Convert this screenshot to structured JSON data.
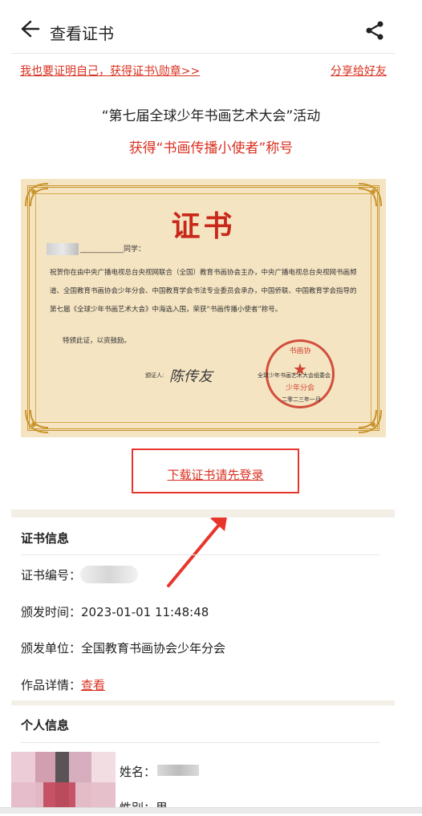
{
  "header": {
    "title": "查看证书",
    "back_icon": "back-arrow-icon",
    "share_icon": "share-icon"
  },
  "links": {
    "prove_self": "我也要证明自己，获得证书\\勋章>>",
    "share_friend": "分享给好友"
  },
  "event": {
    "name": "“第七届全球少年书画艺术大会”活动",
    "award": "获得“书画传播小使者”称号"
  },
  "certificate": {
    "title": "证书",
    "greeting": "____________同学：",
    "body": "祝贺你在由中央广播电视总台央视网联合（全国）教育书画协会主办，中央广播电视总台央视网书画频道、全国教育书画协会少年分会、中国教育学会书法专业委员会承办，中国侨联、中国教育学会指导的第七届《全球少年书画艺术大会》中海选入围，荣获“书画传播小使者”称号。",
    "tail": "特颁此证，以资鼓励。",
    "signer_label": "颁证人:",
    "signature": "陈传友",
    "org": "全球少年书画艺术大会组委会",
    "date": "二零二三年一月",
    "seal_top": "书画协",
    "seal_bottom": "少年分会",
    "colors": {
      "paper": "#f5e4c2",
      "gold": "#c8952e",
      "seal": "#c8281a"
    }
  },
  "download": {
    "label": "下载证书请先登录"
  },
  "cert_info": {
    "section_title": "证书信息",
    "number_label": "证书编号：",
    "time_label": "颁发时间：",
    "time_value": "2023-01-01 11:48:48",
    "issuer_label": "颁发单位：",
    "issuer_value": "全国教育书画协会少年分会",
    "work_label": "作品详情：",
    "work_link": "查看"
  },
  "personal_info": {
    "section_title": "个人信息",
    "name_label": "姓名：",
    "gender_label": "性别：男"
  },
  "colors": {
    "accent_red": "#d9301f",
    "box_red": "#e8352b"
  }
}
